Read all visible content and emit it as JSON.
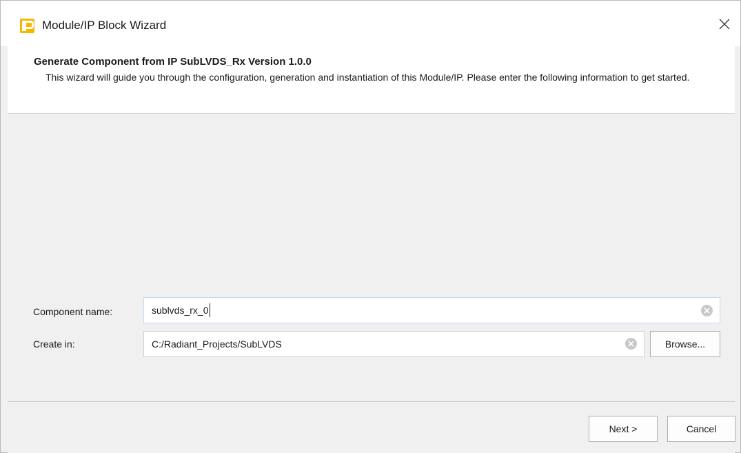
{
  "window": {
    "title": "Module/IP Block Wizard",
    "app_icon": "radiant-logo-icon",
    "close_icon": "close-icon"
  },
  "header": {
    "title": "Generate Component from IP SubLVDS_Rx Version 1.0.0",
    "description": "This wizard will guide you through the configuration, generation and instantiation of this Module/IP. Please enter the following information to get started."
  },
  "form": {
    "component_name_label": "Component name:",
    "component_name_value": "sublvds_rx_0",
    "create_in_label": "Create in:",
    "create_in_value": "C:/Radiant_Projects/SubLVDS",
    "browse_label": "Browse..."
  },
  "footer": {
    "next_label": "Next >",
    "cancel_label": "Cancel"
  },
  "colors": {
    "accent": "#f5b800",
    "focus_border": "#c6d8f0"
  }
}
